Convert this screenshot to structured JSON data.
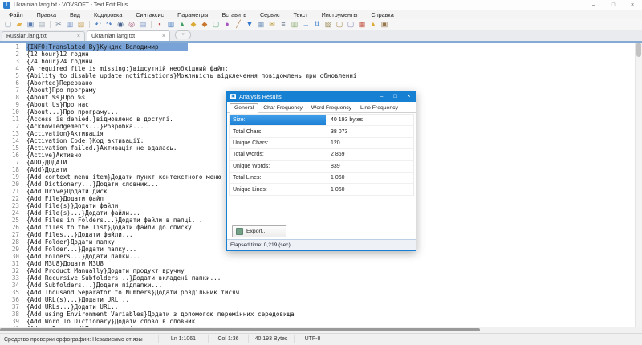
{
  "window": {
    "title": "Ukrainian.lang.txt - VOVSOFT - Text Edit Plus",
    "app_icon_letter": "T"
  },
  "icons": {
    "minimize": "–",
    "maximize": "□",
    "close": "×",
    "tab_close": "×",
    "tab_search": "○",
    "dialog_icon": "▣"
  },
  "menu": {
    "items": [
      "Файл",
      "Правка",
      "Вид",
      "Кодировка",
      "Синтаксис",
      "Параметры",
      "Вставить",
      "Сервис",
      "Текст",
      "Инструменты",
      "Справка"
    ]
  },
  "toolbar": {
    "groups": [
      [
        {
          "name": "new-file-icon",
          "glyph": "▢",
          "color": "#7f95a8"
        },
        {
          "name": "open-folder-icon",
          "glyph": "▰",
          "color": "#e2b24e"
        },
        {
          "name": "save-icon",
          "glyph": "▣",
          "color": "#5a7cb0"
        },
        {
          "name": "print-icon",
          "glyph": "▤",
          "color": "#93a1ad"
        }
      ],
      [
        {
          "name": "cut-icon",
          "glyph": "✂",
          "color": "#6e7e92"
        },
        {
          "name": "copy-icon",
          "glyph": "▥",
          "color": "#6e8ec2"
        },
        {
          "name": "paste-icon",
          "glyph": "▨",
          "color": "#c7a156"
        }
      ],
      [
        {
          "name": "undo-icon",
          "glyph": "↶",
          "color": "#3e74c2"
        },
        {
          "name": "redo-icon",
          "glyph": "↷",
          "color": "#3e74c2"
        },
        {
          "name": "zoom-icon",
          "glyph": "◉",
          "color": "#49648f"
        },
        {
          "name": "find-replace-icon",
          "glyph": "◎",
          "color": "#9e4a6e"
        },
        {
          "name": "print-preview-icon",
          "glyph": "▤",
          "color": "#6e8ec2"
        }
      ],
      [
        {
          "name": "bookmark-icon",
          "glyph": "▪",
          "color": "#c24d4d"
        },
        {
          "name": "printer-color-icon",
          "glyph": "▥",
          "color": "#4a7fc2"
        },
        {
          "name": "insert-image-icon",
          "glyph": "▲",
          "color": "#3f9e60"
        },
        {
          "name": "lock-icon",
          "glyph": "◆",
          "color": "#dcab36"
        },
        {
          "name": "unlock-icon",
          "glyph": "◆",
          "color": "#c9762f"
        },
        {
          "name": "script-file-icon",
          "glyph": "▢",
          "color": "#57a878"
        },
        {
          "name": "color-picker-icon",
          "glyph": "●",
          "color": "#a857c2"
        },
        {
          "name": "pencil-icon",
          "glyph": "╱",
          "color": "#b5864c"
        },
        {
          "name": "filter-icon",
          "glyph": "▼",
          "color": "#3377cc"
        },
        {
          "name": "insert-table-icon",
          "glyph": "▦",
          "color": "#7596ba"
        },
        {
          "name": "send-email-icon",
          "glyph": "✉",
          "color": "#bd9a36"
        },
        {
          "name": "numbered-list-icon",
          "glyph": "≡",
          "color": "#68798c"
        },
        {
          "name": "format-painter-icon",
          "glyph": "▥",
          "color": "#86a868"
        },
        {
          "name": "go-to-icon",
          "glyph": "→",
          "color": "#3377cc"
        },
        {
          "name": "sort-icon",
          "glyph": "⇅",
          "color": "#3377cc"
        },
        {
          "name": "clipboard-history-icon",
          "glyph": "▧",
          "color": "#96824f"
        },
        {
          "name": "rename-icon",
          "glyph": "▢",
          "color": "#a8884a"
        },
        {
          "name": "modify-icon",
          "glyph": "▢",
          "color": "#8689b8"
        },
        {
          "name": "calendar-icon",
          "glyph": "▦",
          "color": "#c25544"
        },
        {
          "name": "case-icon",
          "glyph": "▲",
          "color": "#dcab36"
        },
        {
          "name": "exit-icon",
          "glyph": "▣",
          "color": "#95764f"
        }
      ]
    ]
  },
  "tabs": [
    {
      "label": "Russian.lang.txt",
      "active": false
    },
    {
      "label": "Ukrainian.lang.txt",
      "active": true
    }
  ],
  "editor": {
    "selected_line": 1,
    "lines": [
      "{INFO:Translated By}Кундис Володимир",
      "{12 hour}12 годин",
      "{24 hour}24 години",
      "{A required file is missing:}відсутній необхідний файл:",
      "{Ability to disable update notifications}Можливість відклечення повідомлень при обновленні",
      "{Aborted}Перервано",
      "{About}Про програму",
      "{About %s}Про %s",
      "{About Us}Про нас",
      "{About...}Про програму...",
      "{Access is denied.}відмовлено в доступі.",
      "{Acknowledgements...}Розробка...",
      "{Activation}Активація",
      "{Activation Code:}Код активації:",
      "{Activation failed.}Активація не вдалась.",
      "{Active}Активно",
      "{ADD}ДОДАТИ",
      "{Add}Додати",
      "{Add context menu item}Додати пункт контекстного меню",
      "{Add Dictionary...}Додати словник...",
      "{Add Drive}Додати диск",
      "{Add File}Додати файл",
      "{Add File(s)}Додати файли",
      "{Add File(s)...}Додати файли...",
      "{Add Files in Folders...}Додати файли в папці...",
      "{Add files to the list}Додати файли до списку",
      "{Add Files...}Додати файли...",
      "{Add Folder}Додати папку",
      "{Add Folder...}Додати папку...",
      "{Add Folders...}Додати папки...",
      "{Add M3U8}Додати M3U8",
      "{Add Product Manually}Додати продукт вручну",
      "{Add Recursive Subfolders...}Додати вкладені папки...",
      "{Add Subfolders...}Додати підпапки...",
      "{Add Thousand Separator to Numbers}Додати роздільник тисяч",
      "{Add URL(s)...}Додати URL...",
      "{Add URLs...}Додати URL...",
      "{Add using Environment Variables}Додати з допомогою перемінних середовища",
      "{Add Word To Dictionary}Додати слово в словник",
      "{Admin Password}Пароль адміністратора"
    ]
  },
  "dialog": {
    "title": "Analysis Results",
    "tabs": [
      "General",
      "Char Frequency",
      "Word Frequency",
      "Line Frequency"
    ],
    "active_tab": "General",
    "rows": [
      {
        "label": "Size:",
        "value": "40 193 bytes",
        "selected": true
      },
      {
        "label": "Total Chars:",
        "value": "38 073",
        "selected": false
      },
      {
        "label": "Unique Chars:",
        "value": "120",
        "selected": false
      },
      {
        "label": "Total Words:",
        "value": "2 869",
        "selected": false
      },
      {
        "label": "Unique Words:",
        "value": "839",
        "selected": false
      },
      {
        "label": "Total Lines:",
        "value": "1 060",
        "selected": false
      },
      {
        "label": "Unique Lines:",
        "value": "1 060",
        "selected": false
      }
    ],
    "export_label": "Export...",
    "status": "Elapsed time: 0,219 (sec)"
  },
  "statusbar": {
    "spell": "Средство проверки орфографии: Независимо от язы",
    "line": "Ln 1:1061",
    "column": "Col 1:36",
    "size": "40 193 Bytes",
    "encoding": "UTF-8"
  },
  "colors": {
    "accent": "#1681d2",
    "selection": "#79a3d6",
    "tab_strip": "#85abd5"
  }
}
